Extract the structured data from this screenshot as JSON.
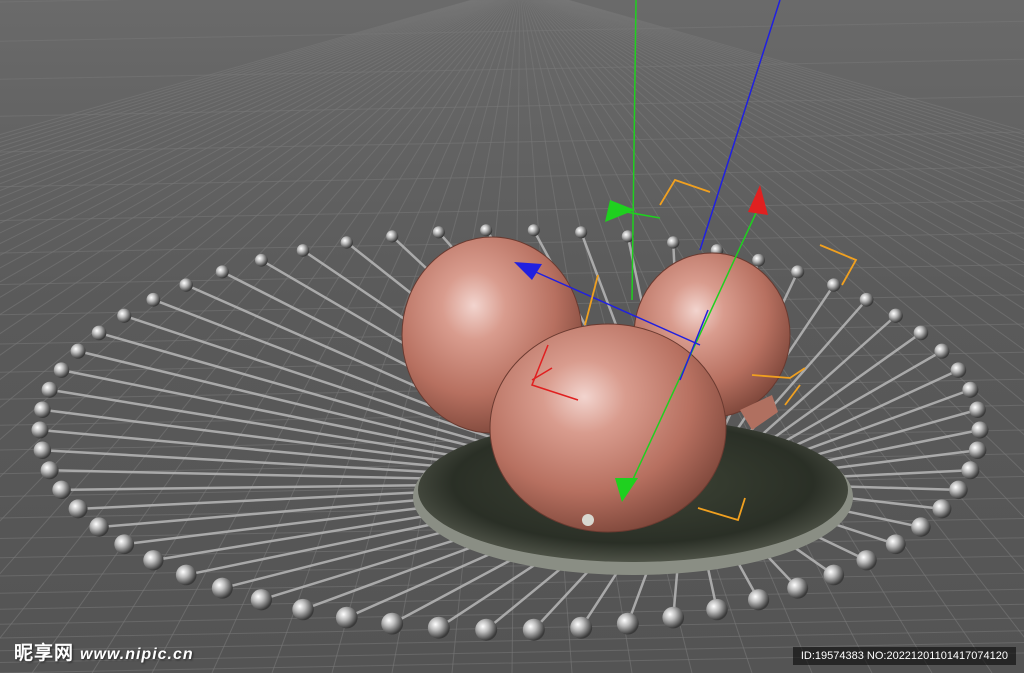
{
  "watermark": {
    "brand": "昵享网",
    "site": "www.nipic.cn",
    "id_text": "ID:19574383 NO:20221201101417074120"
  },
  "colors": {
    "viewport_bg": "#5e5e5e",
    "grid_line": "#787878",
    "axis_x": "#e02020",
    "axis_y": "#1fd01f",
    "axis_z": "#2020e0",
    "selection_corner": "#f0a020",
    "fruit": "#c98878",
    "plate": "#2e332c",
    "rod": "#b8b8b8"
  },
  "scene_objects": {
    "fruits": [
      "pomegranate",
      "pomegranate",
      "pomegranate"
    ],
    "plate": "plate",
    "rods": "metal rods with ball tips",
    "gizmo": "move-gizmo"
  }
}
